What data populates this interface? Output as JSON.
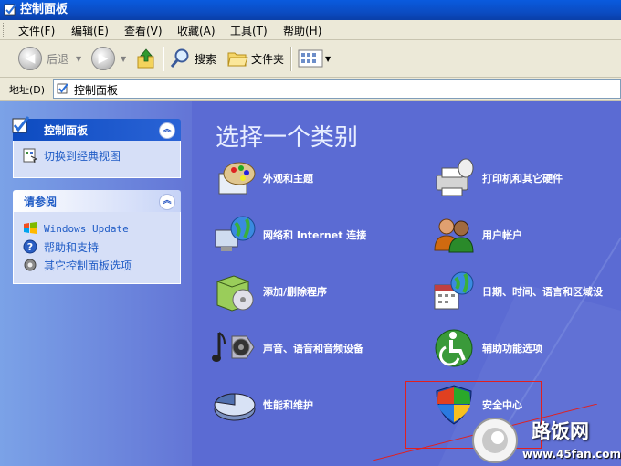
{
  "window": {
    "title": "控制面板"
  },
  "menu": [
    "文件(F)",
    "编辑(E)",
    "查看(V)",
    "收藏(A)",
    "工具(T)",
    "帮助(H)"
  ],
  "toolbar": {
    "back": "后退",
    "search": "搜索",
    "folders": "文件夹"
  },
  "address": {
    "label": "地址(D)",
    "value": "控制面板"
  },
  "side_panels": {
    "control_panel": {
      "title": "控制面板",
      "items": [
        "切换到经典视图"
      ]
    },
    "see_also": {
      "title": "请参阅",
      "items": [
        "Windows Update",
        "帮助和支持",
        "其它控制面板选项"
      ]
    }
  },
  "main": {
    "heading": "选择一个类别",
    "categories": [
      "外观和主题",
      "打印机和其它硬件",
      "网络和 Internet 连接",
      "用户帐户",
      "添加/删除程序",
      "日期、时间、语言和区域设",
      "声音、语音和音频设备",
      "辅助功能选项",
      "性能和维护",
      "安全中心"
    ]
  },
  "watermark": {
    "name": "路饭网",
    "url": "www.45fan.com"
  },
  "colors": {
    "title_bar": "#0b4cc3",
    "task_pane": "#6375d6",
    "main_bg": "#5b6bd3",
    "highlight": "#e02020"
  }
}
